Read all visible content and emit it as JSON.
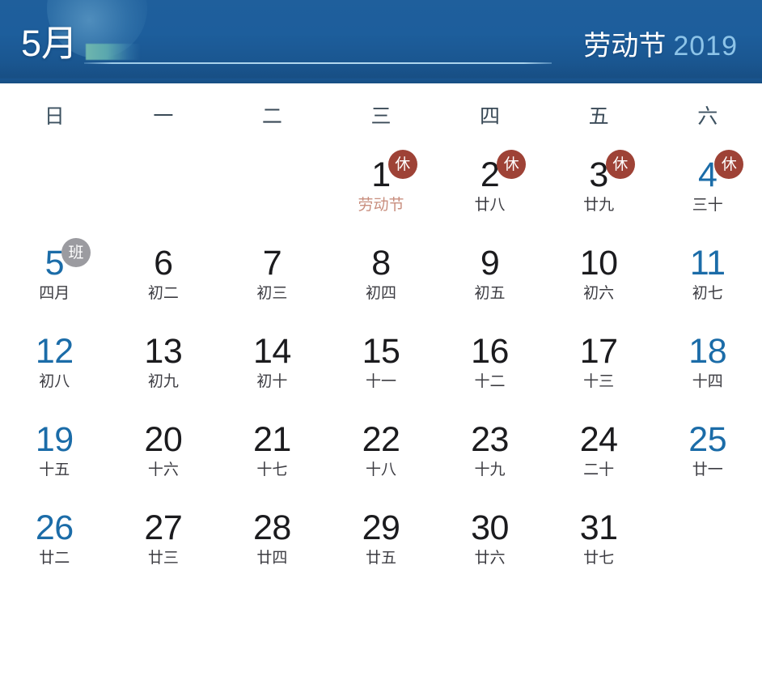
{
  "header": {
    "month_label": "5月",
    "festival": "劳动节",
    "year": "2019",
    "accent_color": "#6fb6ae",
    "background_color": "#1d5e9c",
    "year_color": "#8dc4e8"
  },
  "weekdays": [
    {
      "label": "日",
      "weekend": true
    },
    {
      "label": "一",
      "weekend": false
    },
    {
      "label": "二",
      "weekend": false
    },
    {
      "label": "三",
      "weekend": false
    },
    {
      "label": "四",
      "weekend": false
    },
    {
      "label": "五",
      "weekend": false
    },
    {
      "label": "六",
      "weekend": true
    }
  ],
  "legend": {
    "rest_badge": "休",
    "work_badge": "班",
    "rest_color": "#9e4236",
    "work_color": "#9b9ba0",
    "weekend_color": "#1b6ca8",
    "festival_color": "#c98f7f"
  },
  "weeks": [
    [
      {
        "day": "",
        "lunar": "",
        "empty": true
      },
      {
        "day": "",
        "lunar": "",
        "empty": true
      },
      {
        "day": "",
        "lunar": "",
        "empty": true
      },
      {
        "day": "1",
        "lunar": "劳动节",
        "badge": "休",
        "badge_type": "rest",
        "festival": true
      },
      {
        "day": "2",
        "lunar": "廿八",
        "badge": "休",
        "badge_type": "rest"
      },
      {
        "day": "3",
        "lunar": "廿九",
        "badge": "休",
        "badge_type": "rest"
      },
      {
        "day": "4",
        "lunar": "三十",
        "badge": "休",
        "badge_type": "rest",
        "weekend": true
      }
    ],
    [
      {
        "day": "5",
        "lunar": "四月",
        "badge": "班",
        "badge_type": "work",
        "weekend": true
      },
      {
        "day": "6",
        "lunar": "初二"
      },
      {
        "day": "7",
        "lunar": "初三"
      },
      {
        "day": "8",
        "lunar": "初四"
      },
      {
        "day": "9",
        "lunar": "初五"
      },
      {
        "day": "10",
        "lunar": "初六"
      },
      {
        "day": "11",
        "lunar": "初七",
        "weekend": true
      }
    ],
    [
      {
        "day": "12",
        "lunar": "初八",
        "weekend": true
      },
      {
        "day": "13",
        "lunar": "初九"
      },
      {
        "day": "14",
        "lunar": "初十"
      },
      {
        "day": "15",
        "lunar": "十一"
      },
      {
        "day": "16",
        "lunar": "十二"
      },
      {
        "day": "17",
        "lunar": "十三"
      },
      {
        "day": "18",
        "lunar": "十四",
        "weekend": true
      }
    ],
    [
      {
        "day": "19",
        "lunar": "十五",
        "weekend": true
      },
      {
        "day": "20",
        "lunar": "十六"
      },
      {
        "day": "21",
        "lunar": "十七"
      },
      {
        "day": "22",
        "lunar": "十八"
      },
      {
        "day": "23",
        "lunar": "十九"
      },
      {
        "day": "24",
        "lunar": "二十"
      },
      {
        "day": "25",
        "lunar": "廿一",
        "weekend": true
      }
    ],
    [
      {
        "day": "26",
        "lunar": "廿二",
        "weekend": true
      },
      {
        "day": "27",
        "lunar": "廿三"
      },
      {
        "day": "28",
        "lunar": "廿四"
      },
      {
        "day": "29",
        "lunar": "廿五"
      },
      {
        "day": "30",
        "lunar": "廿六"
      },
      {
        "day": "31",
        "lunar": "廿七"
      },
      {
        "day": "",
        "lunar": "",
        "empty": true
      }
    ],
    [
      {
        "day": "",
        "lunar": "",
        "empty": true
      },
      {
        "day": "",
        "lunar": "",
        "empty": true
      },
      {
        "day": "",
        "lunar": "",
        "empty": true
      },
      {
        "day": "",
        "lunar": "",
        "empty": true
      },
      {
        "day": "",
        "lunar": "",
        "empty": true
      },
      {
        "day": "",
        "lunar": "",
        "empty": true
      },
      {
        "day": "",
        "lunar": "",
        "empty": true
      }
    ]
  ]
}
